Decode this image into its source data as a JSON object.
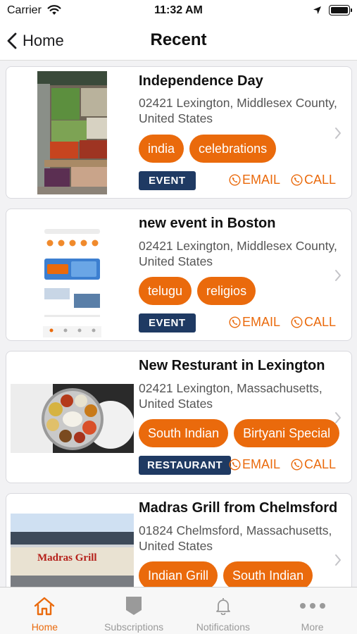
{
  "status_bar": {
    "carrier": "Carrier",
    "time": "11:32 AM"
  },
  "nav": {
    "back_label": "Home",
    "title": "Recent"
  },
  "colors": {
    "accent": "#ea6a0c",
    "badge": "#1f3a63"
  },
  "cards": [
    {
      "title": "Independence Day",
      "address": "02421 Lexington, Middlesex County, United States",
      "tags": [
        "india",
        "celebrations"
      ],
      "type": "EVENT",
      "email_label": "EMAIL",
      "call_label": "CALL"
    },
    {
      "title": "new event in Boston",
      "address": "02421 Lexington, Middlesex County, United States",
      "tags": [
        "telugu",
        "religios"
      ],
      "type": "EVENT",
      "email_label": "EMAIL",
      "call_label": "CALL"
    },
    {
      "title": "New Resturant in Lexington",
      "address": "02421 Lexington, Massachusetts, United States",
      "tags": [
        "South Indian",
        "Birtyani Special"
      ],
      "type": "RESTAURANT",
      "email_label": "EMAIL",
      "call_label": "CALL"
    },
    {
      "title": "Madras Grill from Chelmsford",
      "address": "01824 Chelmsford, Massachusetts, United States",
      "tags": [
        "Indian Grill",
        "South Indian"
      ],
      "thumb_sign": "Madras Grill"
    }
  ],
  "tabs": [
    {
      "label": "Home",
      "icon": "home-icon",
      "active": true
    },
    {
      "label": "Subscriptions",
      "icon": "bookmark-icon"
    },
    {
      "label": "Notifications",
      "icon": "bell-icon"
    },
    {
      "label": "More",
      "icon": "more-icon"
    }
  ]
}
